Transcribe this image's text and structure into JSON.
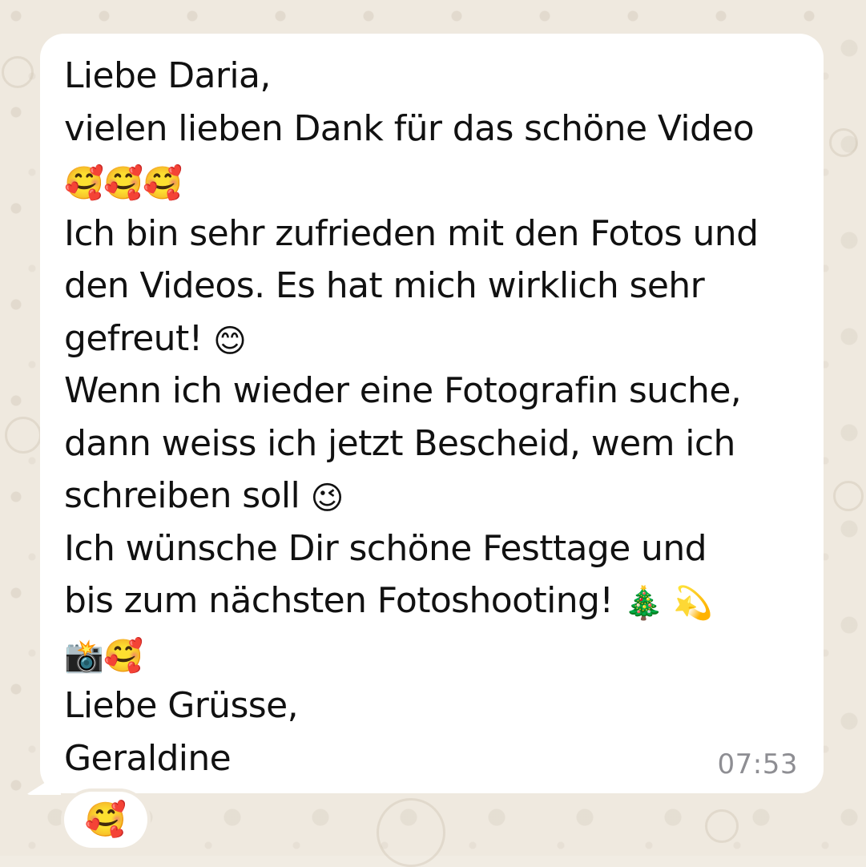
{
  "message": {
    "line_1": "Liebe Daria,",
    "line_2": "vielen lieben Dank für das schöne Video",
    "line_3_emojis": "🥰🥰🥰",
    "line_4": "Ich bin sehr zufrieden mit den Fotos und",
    "line_5": "den Videos. Es hat mich wirklich sehr",
    "line_6_text": "gefreut! ",
    "line_6_emoji": "😊",
    "line_7": "Wenn ich wieder eine Fotografin suche,",
    "line_8": "dann weiss ich jetzt Bescheid, wem ich",
    "line_9_text": "schreiben soll ",
    "line_9_emoji": "😉",
    "line_10": "Ich wünsche Dir schöne Festtage und",
    "line_11_text": "bis zum nächsten Fotoshooting! ",
    "line_11_emojis": "🎄 💫",
    "line_12_emojis": "📸🥰",
    "line_13": "Liebe Grüsse,",
    "line_14": "Geraldine",
    "timestamp": "07:53"
  },
  "reaction": {
    "emoji": "🥰"
  }
}
